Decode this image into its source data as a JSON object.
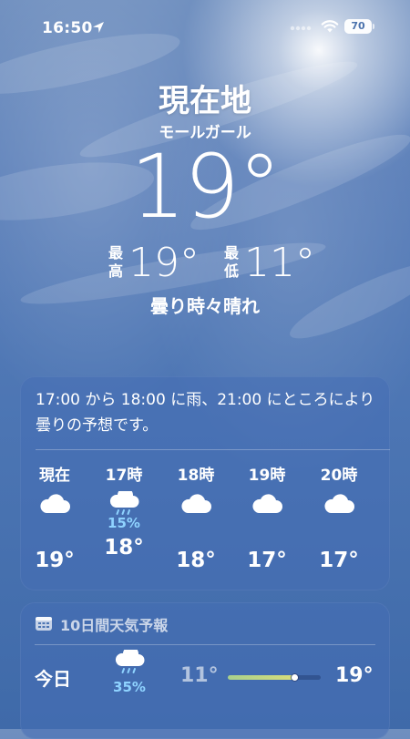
{
  "status_bar": {
    "time": "16:50",
    "battery": "70",
    "icons": [
      "location-arrow-icon",
      "cellular-icon",
      "wifi-icon",
      "battery-icon"
    ]
  },
  "header": {
    "location": "現在地",
    "sublocation": "モールガール",
    "current_temp": "19°",
    "high_label": "最高",
    "high_temp": "19°",
    "low_label": "最低",
    "low_temp": "11°",
    "condition": "曇り時々晴れ"
  },
  "hourly": {
    "summary": "17:00 から 18:00 に雨、21:00 にところにより曇りの予想です。",
    "hours": [
      {
        "label": "現在",
        "icon": "cloud-icon",
        "precip": "",
        "temp": "19°"
      },
      {
        "label": "17時",
        "icon": "cloud-rain-icon",
        "precip": "15%",
        "temp": "18°"
      },
      {
        "label": "18時",
        "icon": "cloud-icon",
        "precip": "",
        "temp": "18°"
      },
      {
        "label": "19時",
        "icon": "cloud-icon",
        "precip": "",
        "temp": "17°"
      },
      {
        "label": "20時",
        "icon": "cloud-icon",
        "precip": "",
        "temp": "17°"
      }
    ]
  },
  "daily": {
    "title": "10日間天気予報",
    "title_icon": "calendar-icon",
    "days": [
      {
        "label": "今日",
        "icon": "cloud-rain-icon",
        "precip": "35%",
        "low": "11°",
        "high": "19°",
        "range_start": 0.0,
        "range_end": 0.72,
        "current_marker": 0.72
      }
    ]
  },
  "colors": {
    "precip": "#8fd3ff",
    "range_gradient_start": "#a8d08d",
    "range_gradient_end": "#d7dc7a"
  }
}
